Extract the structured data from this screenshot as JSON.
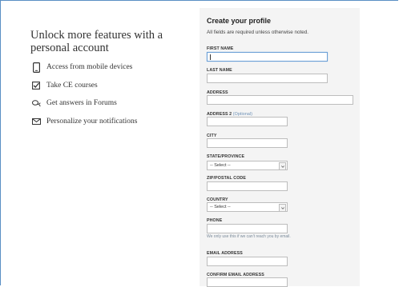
{
  "left": {
    "headline": "Unlock more features with a personal account",
    "features": [
      {
        "icon": "mobile-icon",
        "label": "Access from mobile devices"
      },
      {
        "icon": "checkbox-icon",
        "label": "Take CE courses"
      },
      {
        "icon": "chat-bubbles-icon",
        "label": "Get answers in Forums"
      },
      {
        "icon": "envelope-icon",
        "label": "Personalize your notifications"
      }
    ]
  },
  "form": {
    "title": "Create your profile",
    "subtitle": "All fields are required unless otherwise noted.",
    "first_name_label": "FIRST NAME",
    "last_name_label": "LAST NAME",
    "address_label": "ADDRESS",
    "address2_label": "ADDRESS 2",
    "address2_optional": "(Optional)",
    "city_label": "CITY",
    "state_label": "STATE/PROVINCE",
    "state_value": "-- Select --",
    "zip_label": "ZIP/POSTAL CODE",
    "country_label": "COUNTRY",
    "country_value": "-- Select --",
    "phone_label": "PHONE",
    "phone_help": "We only use this if we can't reach you by email.",
    "email_label": "EMAIL ADDRESS",
    "confirm_email_label": "CONFIRM EMAIL ADDRESS"
  }
}
